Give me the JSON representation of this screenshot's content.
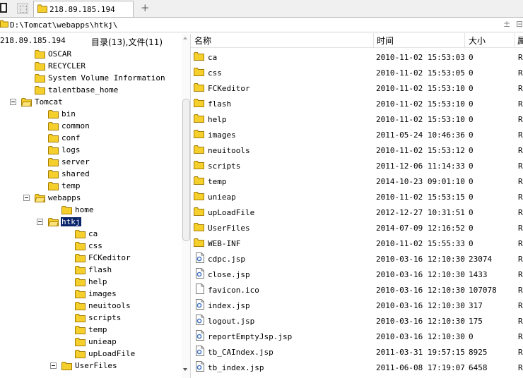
{
  "colors": {
    "folder": "#f5cf2c",
    "folder_edge": "#a57d06",
    "selection": "#0a246a"
  },
  "tabs": {
    "active_tab_label": "218.89.185.194",
    "add_tab_symbol": "+"
  },
  "path": {
    "value": "D:\\Tomcat\\webapps\\htkj\\",
    "right_icon_1": "±",
    "right_icon_2": "⊟"
  },
  "left_panel": {
    "server_label": "218.89.185.194",
    "summary": "目录(13),文件(11)"
  },
  "tree": [
    {
      "label": "OSCAR",
      "icon": "folder-icon",
      "toggle": false
    },
    {
      "label": "RECYCLER",
      "icon": "folder-icon",
      "toggle": false
    },
    {
      "label": "System Volume Information",
      "icon": "folder-icon",
      "toggle": false
    },
    {
      "label": "talentbase_home",
      "icon": "folder-icon",
      "toggle": false
    },
    {
      "label": "Tomcat",
      "icon": "folder-open-icon",
      "toggle": true
    },
    {
      "label": "bin",
      "icon": "folder-icon",
      "toggle": false
    },
    {
      "label": "common",
      "icon": "folder-icon",
      "toggle": false
    },
    {
      "label": "conf",
      "icon": "folder-icon",
      "toggle": false
    },
    {
      "label": "logs",
      "icon": "folder-icon",
      "toggle": false
    },
    {
      "label": "server",
      "icon": "folder-icon",
      "toggle": false
    },
    {
      "label": "shared",
      "icon": "folder-icon",
      "toggle": false
    },
    {
      "label": "temp",
      "icon": "folder-icon",
      "toggle": false
    },
    {
      "label": "webapps",
      "icon": "folder-open-icon",
      "toggle": true
    },
    {
      "label": "home",
      "icon": "folder-icon",
      "toggle": false
    },
    {
      "label": "htkj",
      "icon": "folder-open-icon",
      "toggle": true,
      "selected": true
    },
    {
      "label": "ca",
      "icon": "folder-icon",
      "toggle": false
    },
    {
      "label": "css",
      "icon": "folder-icon",
      "toggle": false
    },
    {
      "label": "FCKeditor",
      "icon": "folder-icon",
      "toggle": false
    },
    {
      "label": "flash",
      "icon": "folder-icon",
      "toggle": false
    },
    {
      "label": "help",
      "icon": "folder-icon",
      "toggle": false
    },
    {
      "label": "images",
      "icon": "folder-icon",
      "toggle": false
    },
    {
      "label": "neuitools",
      "icon": "folder-icon",
      "toggle": false
    },
    {
      "label": "scripts",
      "icon": "folder-icon",
      "toggle": false
    },
    {
      "label": "temp",
      "icon": "folder-icon",
      "toggle": false
    },
    {
      "label": "unieap",
      "icon": "folder-icon",
      "toggle": false
    },
    {
      "label": "upLoadFile",
      "icon": "folder-icon",
      "toggle": false
    },
    {
      "label": "UserFiles",
      "icon": "folder-icon",
      "toggle": true
    }
  ],
  "columns": {
    "name": "名称",
    "time": "时间",
    "size": "大小",
    "extra": "属"
  },
  "files": [
    {
      "name": "ca",
      "time": "2010-11-02 15:53:03",
      "size": "0",
      "attr": "R",
      "icon": "folder-icon"
    },
    {
      "name": "css",
      "time": "2010-11-02 15:53:05",
      "size": "0",
      "attr": "R",
      "icon": "folder-icon"
    },
    {
      "name": "FCKeditor",
      "time": "2010-11-02 15:53:10",
      "size": "0",
      "attr": "R",
      "icon": "folder-icon"
    },
    {
      "name": "flash",
      "time": "2010-11-02 15:53:10",
      "size": "0",
      "attr": "R",
      "icon": "folder-icon"
    },
    {
      "name": "help",
      "time": "2010-11-02 15:53:10",
      "size": "0",
      "attr": "R",
      "icon": "folder-icon"
    },
    {
      "name": "images",
      "time": "2011-05-24 10:46:36",
      "size": "0",
      "attr": "R",
      "icon": "folder-icon"
    },
    {
      "name": "neuitools",
      "time": "2010-11-02 15:53:12",
      "size": "0",
      "attr": "R",
      "icon": "folder-icon"
    },
    {
      "name": "scripts",
      "time": "2011-12-06 11:14:33",
      "size": "0",
      "attr": "R",
      "icon": "folder-icon"
    },
    {
      "name": "temp",
      "time": "2014-10-23 09:01:10",
      "size": "0",
      "attr": "R",
      "icon": "folder-icon"
    },
    {
      "name": "unieap",
      "time": "2010-11-02 15:53:15",
      "size": "0",
      "attr": "R",
      "icon": "folder-icon"
    },
    {
      "name": "upLoadFile",
      "time": "2012-12-27 10:31:51",
      "size": "0",
      "attr": "R",
      "icon": "folder-icon"
    },
    {
      "name": "UserFiles",
      "time": "2014-07-09 12:16:52",
      "size": "0",
      "attr": "R",
      "icon": "folder-icon"
    },
    {
      "name": "WEB-INF",
      "time": "2010-11-02 15:55:33",
      "size": "0",
      "attr": "R",
      "icon": "folder-icon"
    },
    {
      "name": "cdpc.jsp",
      "time": "2010-03-16 12:10:30",
      "size": "23074",
      "attr": "R",
      "icon": "jsp-file-icon"
    },
    {
      "name": "close.jsp",
      "time": "2010-03-16 12:10:30",
      "size": "1433",
      "attr": "R",
      "icon": "jsp-file-icon"
    },
    {
      "name": "favicon.ico",
      "time": "2010-03-16 12:10:30",
      "size": "107078",
      "attr": "R",
      "icon": "blank-file-icon"
    },
    {
      "name": "index.jsp",
      "time": "2010-03-16 12:10:30",
      "size": "317",
      "attr": "R",
      "icon": "jsp-file-icon"
    },
    {
      "name": "logout.jsp",
      "time": "2010-03-16 12:10:30",
      "size": "175",
      "attr": "R",
      "icon": "jsp-file-icon"
    },
    {
      "name": "reportEmptyJsp.jsp",
      "time": "2010-03-16 12:10:30",
      "size": "0",
      "attr": "R",
      "icon": "jsp-file-icon"
    },
    {
      "name": "tb_CAIndex.jsp",
      "time": "2011-03-31 19:57:15",
      "size": "8925",
      "attr": "R",
      "icon": "jsp-file-icon"
    },
    {
      "name": "tb_index.jsp",
      "time": "2011-06-08 17:19:07",
      "size": "6458",
      "attr": "R",
      "icon": "jsp-file-icon"
    }
  ]
}
